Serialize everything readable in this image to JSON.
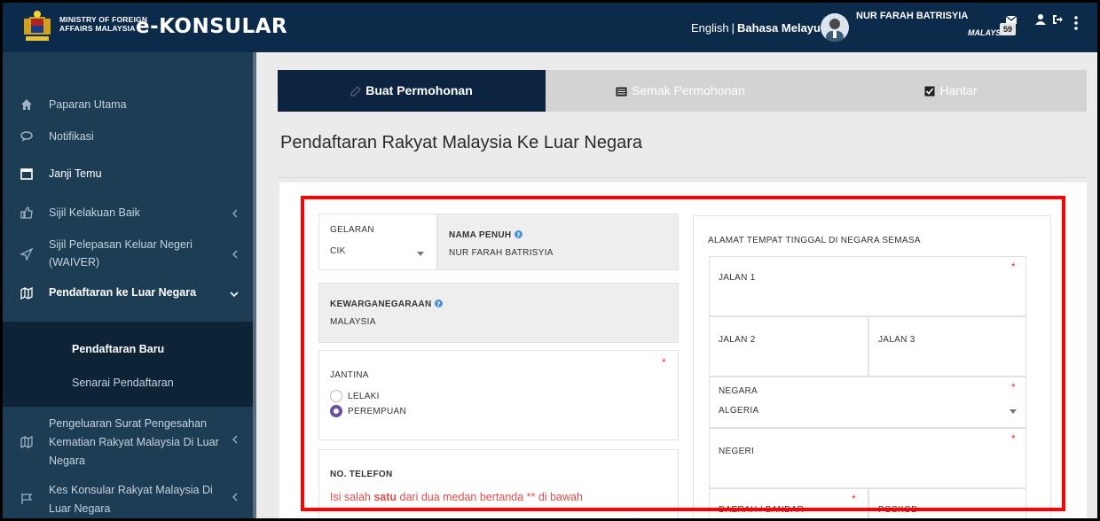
{
  "header": {
    "ministry_line1": "MINISTRY OF FOREIGN",
    "ministry_line2": "AFFAIRS MALAYSIA",
    "brand": "e-KONSULAR",
    "lang_en": "English",
    "lang_sep": "|",
    "lang_bm": "Bahasa Melayu",
    "user_name": "NUR FARAH BATRISYIA",
    "user_country": "MALAYSIA",
    "notification_count": "59"
  },
  "sidebar": {
    "items": [
      {
        "label": "Paparan Utama",
        "icon": "home-icon"
      },
      {
        "label": "Notifikasi",
        "icon": "chat-icon"
      },
      {
        "label": "Janji Temu",
        "icon": "calendar-icon"
      },
      {
        "label": "Sijil Kelakuan Baik",
        "icon": "thumbs-up-icon"
      },
      {
        "label": "Sijil Pelepasan Keluar Negeri",
        "label2": "(WAIVER)",
        "icon": "send-icon"
      },
      {
        "label": "Pendaftaran ke Luar Negara",
        "icon": "map-icon"
      },
      {
        "label": "Pengeluaran Surat Pengesahan",
        "label2": "Kematian Rakyat Malaysia Di Luar",
        "label3": "Negara",
        "icon": "map-icon"
      },
      {
        "label": "Kes Konsular Rakyat Malaysia Di",
        "label2": "Luar Negara",
        "icon": "flag-icon"
      }
    ],
    "sub_items": [
      {
        "label": "Pendaftaran Baru"
      },
      {
        "label": "Senarai Pendaftaran"
      }
    ]
  },
  "steps": [
    {
      "label": "Buat Permohonan"
    },
    {
      "label": "Semak Permohonan"
    },
    {
      "label": "Hantar"
    }
  ],
  "page_title": "Pendaftaran Rakyat Malaysia Ke Luar Negara",
  "form": {
    "gelaran_label": "GELARAN",
    "gelaran_value": "CIK",
    "nama_label": "NAMA PENUH",
    "nama_value": "NUR FARAH BATRISYIA",
    "kewarganegaraan_label": "KEWARGANEGARAAN",
    "kewarganegaraan_value": "MALAYSIA",
    "jantina_label": "JANTINA",
    "jantina_options": [
      "LELAKI",
      "PEREMPUAN"
    ],
    "jantina_selected": "PEREMPUAN",
    "telefon_label": "NO. TELEFON",
    "telefon_hint_pre": "Isi salah ",
    "telefon_hint_bold": "satu",
    "telefon_hint_post": " dari dua medan bertanda ** di bawah",
    "double_star": "**",
    "alamat_label": "ALAMAT TEMPAT TINGGAL DI NEGARA SEMASA",
    "jalan1_label": "JALAN 1",
    "jalan2_label": "JALAN 2",
    "jalan3_label": "JALAN 3",
    "negara_label": "NEGARA",
    "negara_value": "ALGERIA",
    "negeri_label": "NEGERI",
    "daerah_label": "DAERAH / BANDAR",
    "poskod_label": "POSKOD",
    "required_mark": "*"
  },
  "colors": {
    "header_bg": "#0c2a4a",
    "sidebar_bg": "#1d3d55",
    "step_active_bg": "#0c2440",
    "radio_accent": "#6b4fa0",
    "required_red": "#e33333",
    "highlight_red": "#ff0000"
  }
}
